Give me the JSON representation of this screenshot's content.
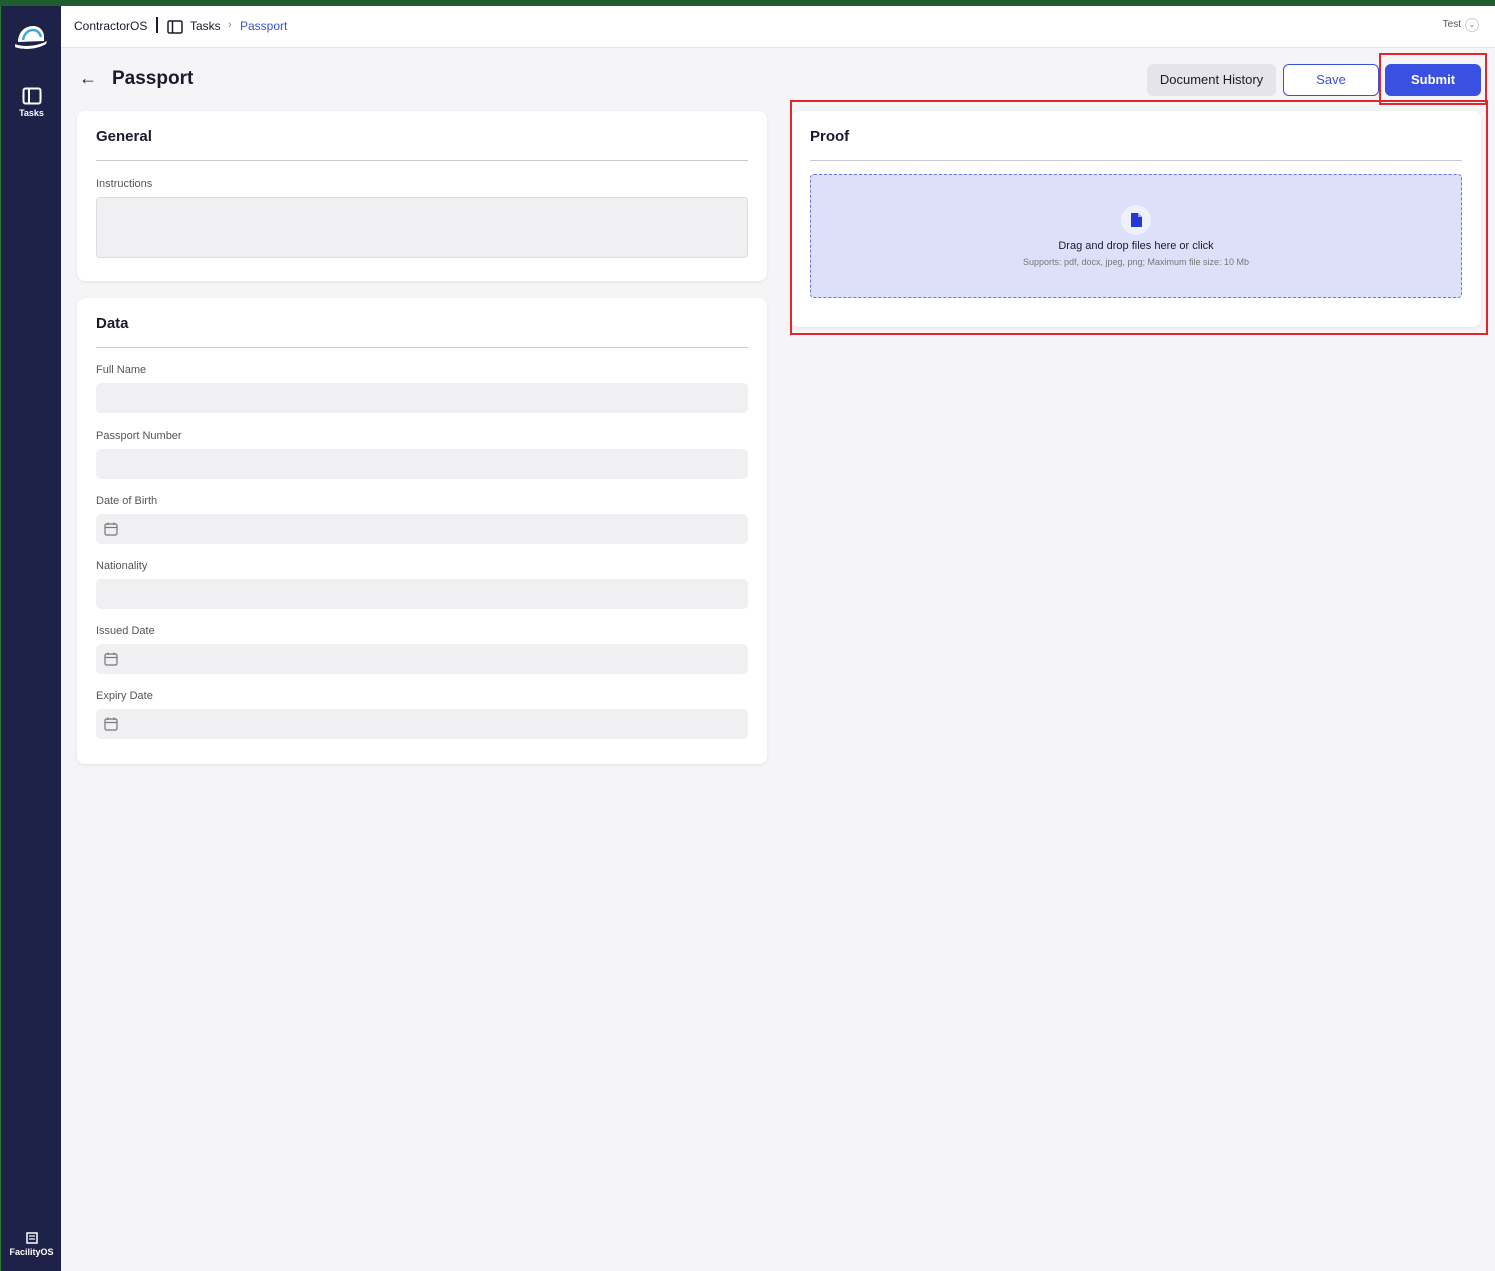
{
  "app": {
    "name": "ContractorOS",
    "user": "Test"
  },
  "sidebar": {
    "tasks_label": "Tasks",
    "facility_label": "FacilityOS"
  },
  "breadcrumb": {
    "tasks": "Tasks",
    "separator": "›",
    "current": "Passport"
  },
  "header": {
    "title": "Passport",
    "back_icon": "arrow-left-icon",
    "history_label": "Document History",
    "save_label": "Save",
    "submit_label": "Submit"
  },
  "general": {
    "title": "General",
    "instructions_label": "Instructions",
    "instructions_value": ""
  },
  "data_section": {
    "title": "Data",
    "fields": [
      {
        "label": "Full Name",
        "value": "",
        "type": "text"
      },
      {
        "label": "Passport Number",
        "value": "",
        "type": "text"
      },
      {
        "label": "Date of Birth",
        "value": "",
        "type": "date"
      },
      {
        "label": "Nationality",
        "value": "",
        "type": "text"
      },
      {
        "label": "Issued Date",
        "value": "",
        "type": "date"
      },
      {
        "label": "Expiry Date",
        "value": "",
        "type": "date"
      }
    ]
  },
  "proof": {
    "title": "Proof",
    "dropzone_text": "Drag and drop files here or click",
    "dropzone_sub": "Supports: pdf, docx, jpeg, png; Maximum file size: 10 Mb"
  },
  "colors": {
    "sidebar": "#1e2148",
    "accent": "#3a50e0",
    "highlight": "#e3262e",
    "dropzone": "#dde0f9"
  }
}
